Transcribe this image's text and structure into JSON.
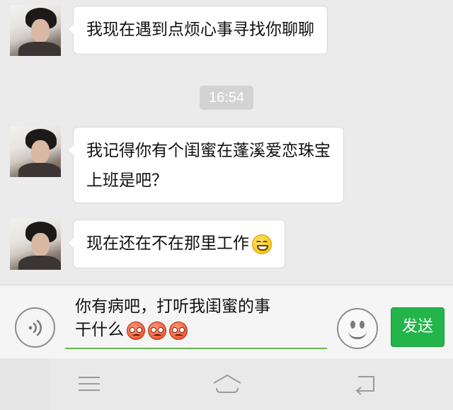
{
  "messages": [
    {
      "text": "我现在遇到点烦心事寻找你聊聊"
    },
    {
      "lines": [
        "我记得你有个闺蜜在蓬溪爱恋珠宝",
        "上班是吧？"
      ]
    },
    {
      "text": "现在还在不在那里工作",
      "emoji": "grinning-sweat-emoji"
    }
  ],
  "timestamp": "16:54",
  "composer": {
    "line1": "你有病吧，打听我闺蜜的事",
    "line2": "干什么",
    "emojis": [
      "angry-emoji",
      "angry-emoji",
      "angry-emoji"
    ],
    "send_label": "发送"
  },
  "colors": {
    "background": "#ebebeb",
    "bubble": "#ffffff",
    "send_button": "#23b54a",
    "input_underline": "#66b84c"
  }
}
